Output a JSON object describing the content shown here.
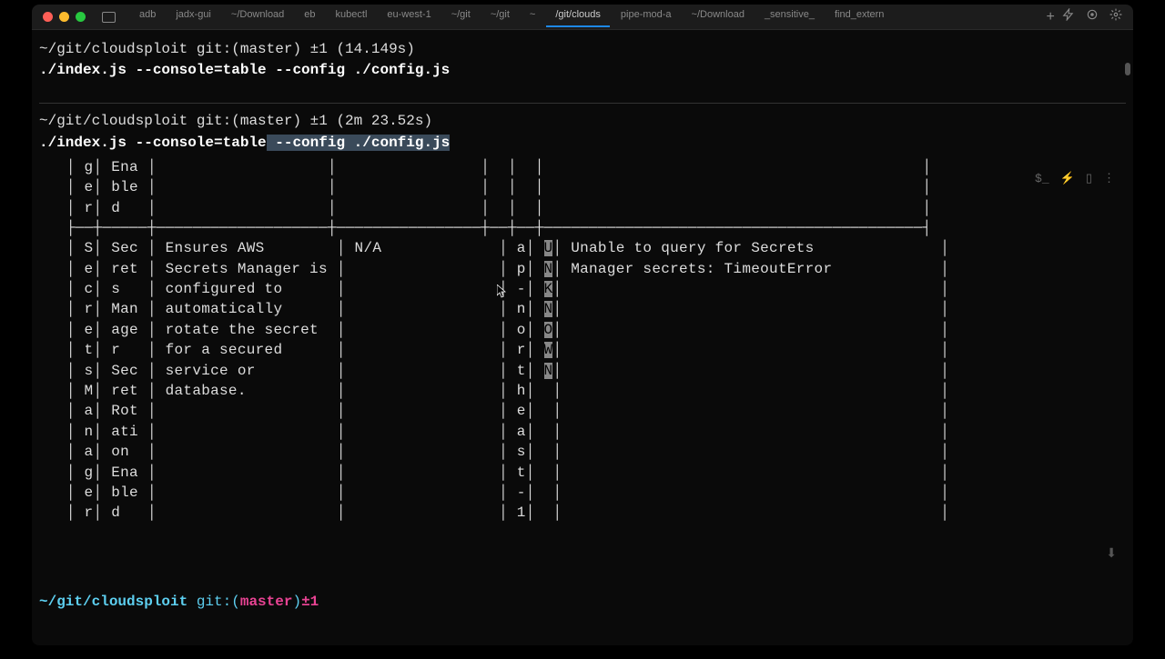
{
  "titlebar": {
    "tabs": [
      "adb",
      "jadx-gui",
      "~/Download",
      "eb",
      "kubectl",
      "eu-west-1",
      "~/git",
      "~/git",
      "~",
      "/git/clouds",
      "pipe-mod-a",
      "~/Download",
      "_sensitive_",
      "find_extern"
    ],
    "active_index": 9
  },
  "block1": {
    "prompt": "~/git/cloudsploit git:(master) ±1 (14.149s)",
    "command": "./index.js --console=table --config ./config.js"
  },
  "block2": {
    "prompt": "~/git/cloudsploit git:(master) ±1 (2m 23.52s)",
    "command_plain": "./index.js --console=table",
    "command_highlight": " --config ./config.js"
  },
  "table": {
    "row1": {
      "col1_lines": [
        "g",
        "e",
        "r"
      ],
      "col2_lines": [
        "Ena",
        "ble",
        "d"
      ]
    },
    "row2": {
      "col1_lines": [
        "S",
        "e",
        "c",
        "r",
        "e",
        "t",
        "s",
        "M",
        "a",
        "n",
        "a",
        "g",
        "e",
        "r"
      ],
      "col2_lines": [
        "Sec",
        "ret",
        "s",
        "Man",
        "age",
        "r",
        "Sec",
        "ret",
        "Rot",
        "ati",
        "on",
        "Ena",
        "ble",
        "d"
      ],
      "col3": "Ensures AWS Secrets Manager is configured to automatically rotate the secret for a secured service or database.",
      "col4": "N/A",
      "col5_lines": [
        "a",
        "p",
        "-",
        "n",
        "o",
        "r",
        "t",
        "h",
        "e",
        "a",
        "s",
        "t",
        "-",
        "1"
      ],
      "col6_lines": [
        "U",
        "N",
        "K",
        "N",
        "O",
        "W",
        "N"
      ],
      "col7": "Unable to query for Secrets Manager secrets: TimeoutError"
    }
  },
  "bottom_prompt": {
    "path": "~/git/cloudsploit ",
    "git_label": "git:(",
    "branch": "master",
    "git_close": ")",
    "diff": "±1"
  }
}
